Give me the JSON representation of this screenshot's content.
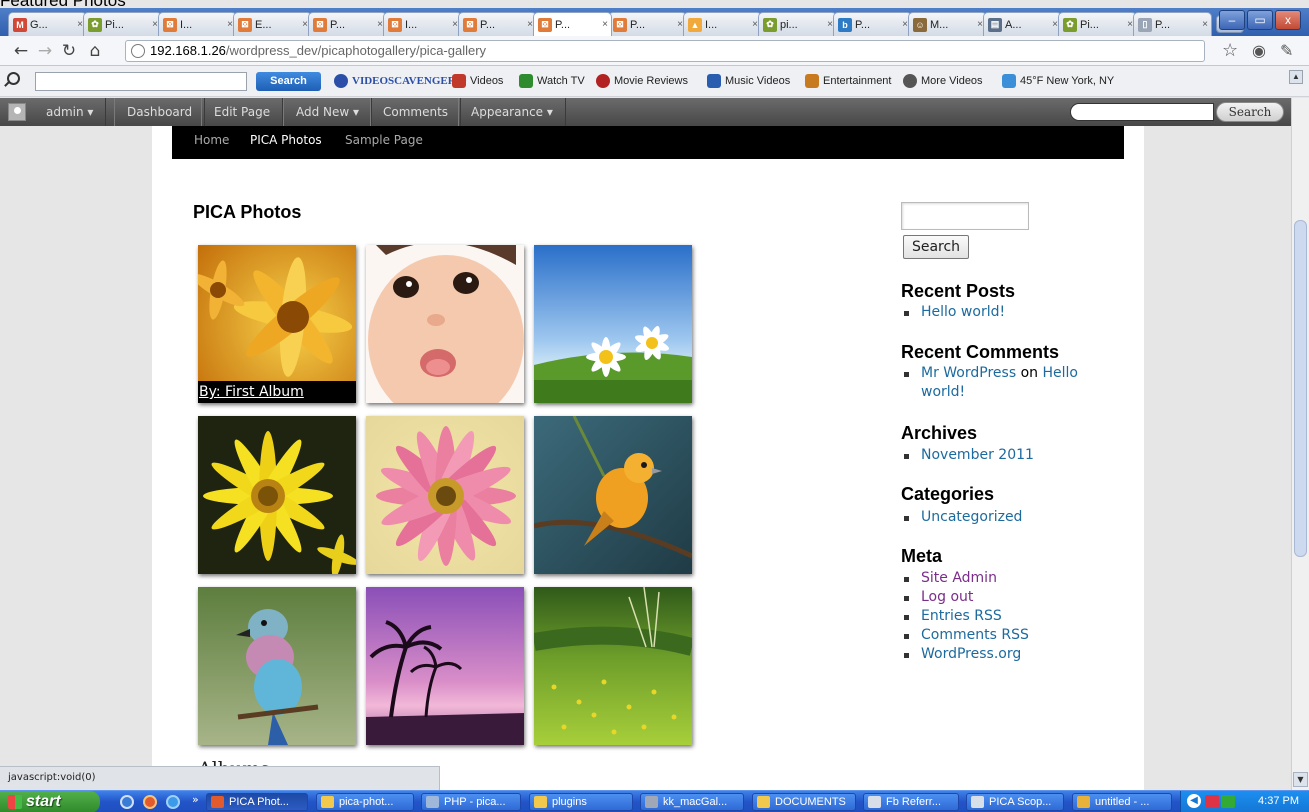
{
  "page_heading_overlay": "Featured Photos",
  "browser": {
    "tabs": [
      {
        "title": "G...",
        "icon": "gmail-icon",
        "color": "#d14836",
        "glyph": "M"
      },
      {
        "title": "Pi...",
        "icon": "picasa-icon",
        "color": "#7a9d2e",
        "glyph": "✿"
      },
      {
        "title": "I...",
        "icon": "joomla-icon",
        "color": "#e07b39",
        "glyph": "⊠"
      },
      {
        "title": "E...",
        "icon": "joomla-icon",
        "color": "#e07b39",
        "glyph": "⊠"
      },
      {
        "title": "P...",
        "icon": "joomla-icon",
        "color": "#e07b39",
        "glyph": "⊠"
      },
      {
        "title": "I...",
        "icon": "joomla-icon",
        "color": "#e07b39",
        "glyph": "⊠"
      },
      {
        "title": "P...",
        "icon": "joomla-icon",
        "color": "#e07b39",
        "glyph": "⊠"
      },
      {
        "title": "P...",
        "icon": "joomla-icon",
        "color": "#e07b39",
        "glyph": "⊠",
        "active": true
      },
      {
        "title": "P...",
        "icon": "joomla-icon",
        "color": "#e07b39",
        "glyph": "⊠"
      },
      {
        "title": "I...",
        "icon": "pma-icon",
        "color": "#f2a93b",
        "glyph": "▲"
      },
      {
        "title": "pi...",
        "icon": "picasa-icon",
        "color": "#7a9d2e",
        "glyph": "✿"
      },
      {
        "title": "P...",
        "icon": "blogger-icon",
        "color": "#2d7bc4",
        "glyph": "b"
      },
      {
        "title": "M...",
        "icon": "person-icon",
        "color": "#8a6a3a",
        "glyph": "☺"
      },
      {
        "title": "A...",
        "icon": "page-icon",
        "color": "#5c6f8a",
        "glyph": "▤"
      },
      {
        "title": "Pi...",
        "icon": "picasa-icon",
        "color": "#7a9d2e",
        "glyph": "✿"
      },
      {
        "title": "P...",
        "icon": "blank-page-icon",
        "color": "#9aa6b5",
        "glyph": "▯"
      }
    ],
    "window_buttons": [
      "–",
      "▭",
      "x"
    ],
    "url_host": "192.168.1.26",
    "url_path": "/wordpress_dev/picaphotogallery/pica-gallery",
    "toolbar": {
      "search_button": "Search",
      "items": [
        {
          "label": "VIDEOSCAVENGER™",
          "color": "#2b4fa8"
        },
        {
          "label": "Videos",
          "color": "#c0392b"
        },
        {
          "label": "Watch TV",
          "color": "#2e8b2e"
        },
        {
          "label": "Movie Reviews",
          "color": "#b22222"
        },
        {
          "label": "Music Videos",
          "color": "#2a5db0"
        },
        {
          "label": "Entertainment",
          "color": "#c87a1e"
        },
        {
          "label": "More Videos",
          "color": "#555555"
        },
        {
          "label": "45°F New York, NY",
          "color": "#3a8fd8"
        }
      ]
    }
  },
  "adminbar": {
    "items": [
      "admin ▾",
      "Dashboard",
      "Edit Page",
      "Add New ▾",
      "Comments",
      "Appearance ▾"
    ],
    "search_button": "Search"
  },
  "site": {
    "menu": [
      "Home",
      "PICA Photos",
      "Sample Page"
    ],
    "current_menu": "PICA Photos",
    "page_title": "PICA Photos",
    "photo_caption": "By: First Album",
    "albums_heading": "Albums",
    "photos": [
      "orange-gerbera",
      "baby-face",
      "white-daisies",
      "yellow-daisy",
      "pink-gerbera",
      "orange-bird",
      "lilac-breasted-roller",
      "purple-palm-sunset",
      "green-meadow"
    ]
  },
  "sidebar": {
    "search_button": "Search",
    "recent_posts_heading": "Recent Posts",
    "recent_posts": [
      "Hello world!"
    ],
    "recent_comments_heading": "Recent Comments",
    "comment_author": "Mr WordPress",
    "comment_on": "on",
    "comment_post_1": "Hello",
    "comment_post_2": "world!",
    "archives_heading": "Archives",
    "archives": [
      "November 2011"
    ],
    "categories_heading": "Categories",
    "categories": [
      "Uncategorized"
    ],
    "meta_heading": "Meta",
    "meta": [
      "Site Admin",
      "Log out",
      "Entries RSS",
      "Comments RSS",
      "WordPress.org"
    ]
  },
  "status_text": "javascript:void(0)",
  "taskbar": {
    "start": "start",
    "tasks": [
      {
        "label": "PICA Phot...",
        "color": "#e25b2c"
      },
      {
        "label": "pica-phot...",
        "color": "#f2c94c"
      },
      {
        "label": "PHP - pica...",
        "color": "#9fb7d8"
      },
      {
        "label": "plugins",
        "color": "#f2c94c"
      },
      {
        "label": "kk_macGal...",
        "color": "#a0a8b8"
      },
      {
        "label": "DOCUMENTS",
        "color": "#f2c94c"
      },
      {
        "label": "Fb Referr...",
        "color": "#d8dfe9"
      },
      {
        "label": "PICA Scop...",
        "color": "#d8dfe9"
      },
      {
        "label": "untitled - ...",
        "color": "#e8b23a"
      }
    ],
    "clock": "4:37 PM"
  }
}
